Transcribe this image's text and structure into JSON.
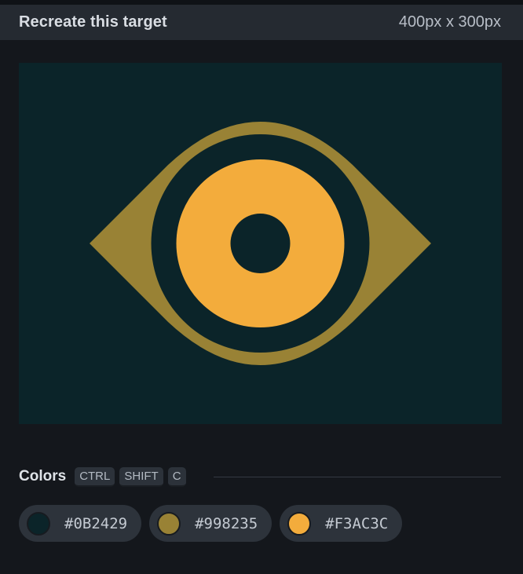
{
  "header": {
    "title": "Recreate this target",
    "size": "400px x 300px"
  },
  "target": {
    "description_colors": {
      "background": "#0B2429",
      "outer": "#998235",
      "inner": "#F3AC3C"
    }
  },
  "colors_section": {
    "label": "Colors",
    "shortcut_keys": [
      "CTRL",
      "SHIFT",
      "C"
    ]
  },
  "swatches": [
    {
      "hex": "#0B2429",
      "color": "#0B2429"
    },
    {
      "hex": "#998235",
      "color": "#998235"
    },
    {
      "hex": "#F3AC3C",
      "color": "#F3AC3C"
    }
  ]
}
